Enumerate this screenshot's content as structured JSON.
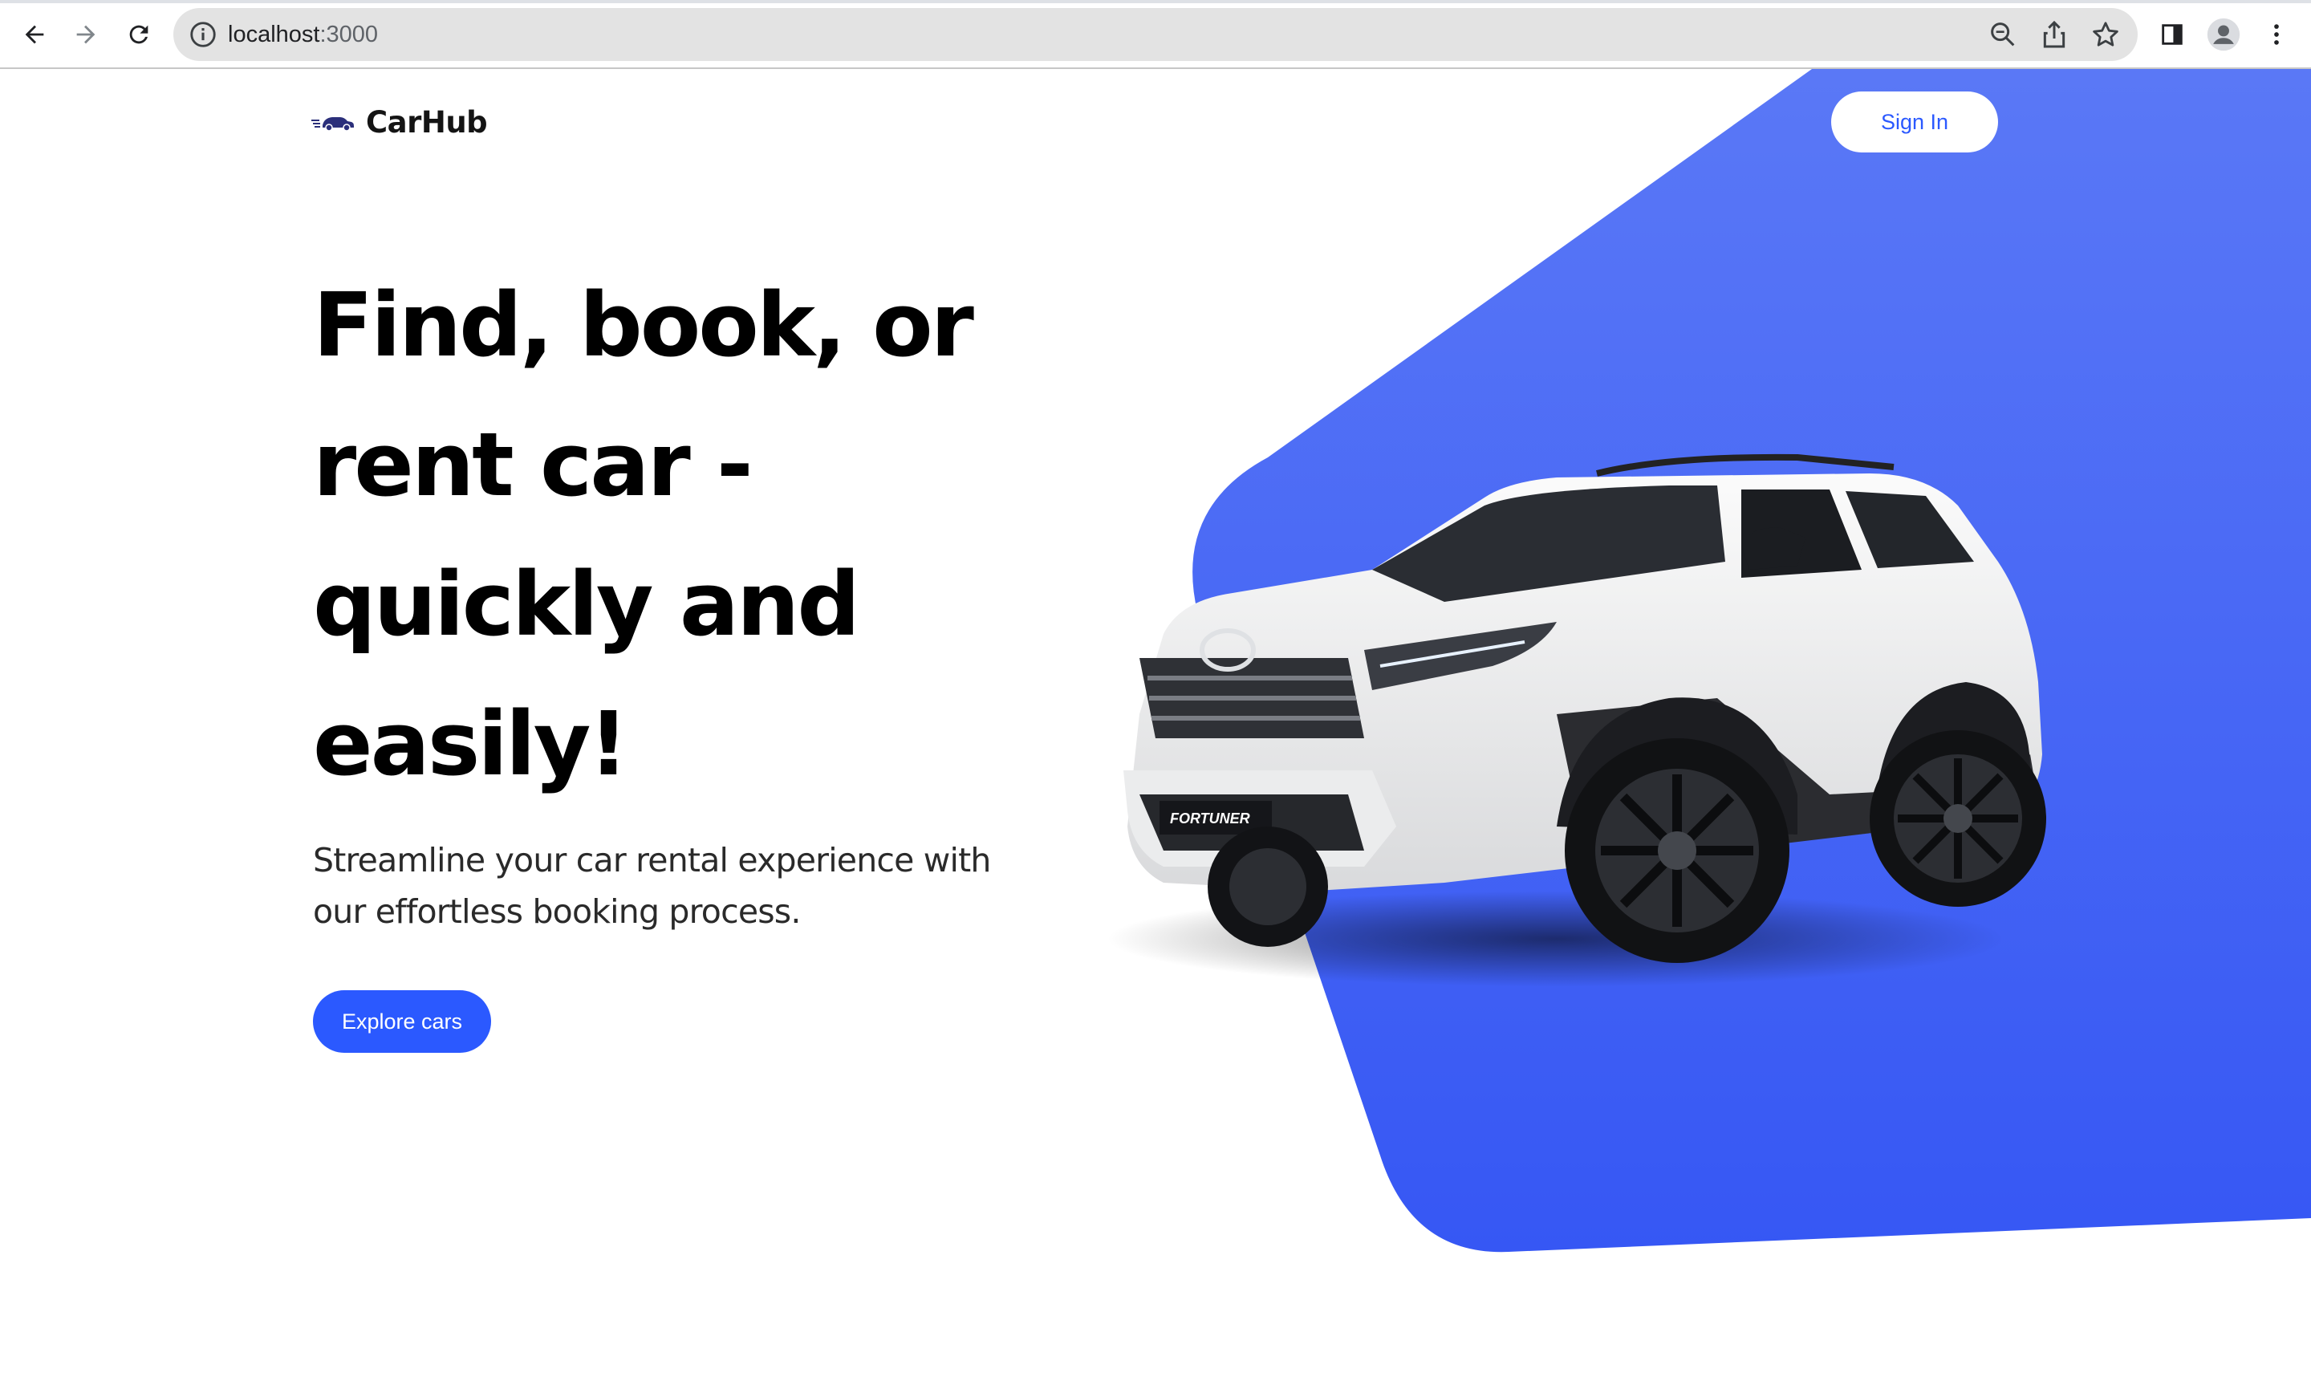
{
  "browser": {
    "url_host": "localhost",
    "url_port": ":3000"
  },
  "header": {
    "brand_name": "CarHub",
    "signin_label": "Sign In"
  },
  "hero": {
    "title_lines": [
      "Find, book, or",
      "rent car -",
      "quickly and",
      "easily!"
    ],
    "subtitle": "Streamline your car rental experience with our effortless booking process.",
    "cta_label": "Explore cars",
    "car_badge": "FORTUNER"
  },
  "colors": {
    "accent": "#2b59ff",
    "shape_blue": "#3b5cf5"
  }
}
